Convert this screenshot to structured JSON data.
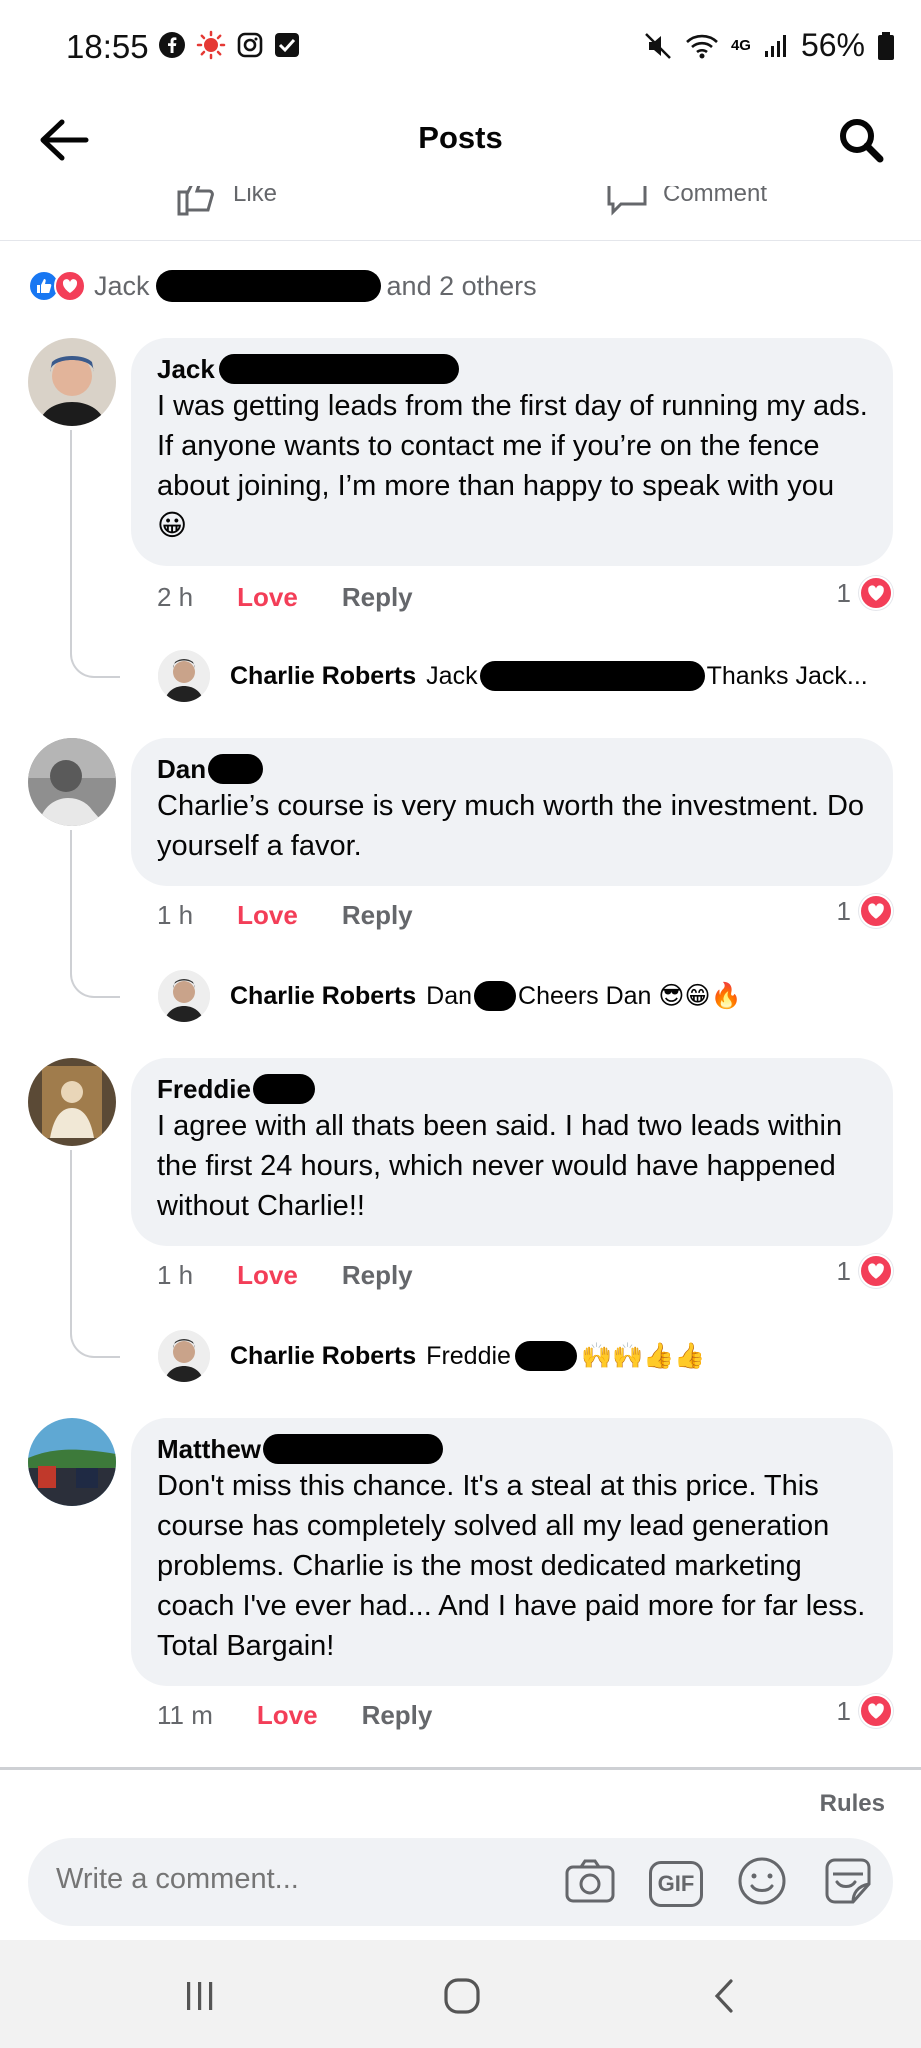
{
  "status_bar": {
    "time": "18:55",
    "battery": "56%",
    "network": "4G"
  },
  "header": {
    "title": "Posts"
  },
  "post_actions": {
    "like_label": "Like",
    "comment_label": "Comment"
  },
  "reactions_summary": {
    "first_name": "Jack",
    "others": "and 2 others"
  },
  "comments": [
    {
      "author": "Jack",
      "text": "I was getting leads from the first day of running my ads. If anyone wants to contact me if you’re on the fence about joining, I’m more than happy to speak with you 😀",
      "time": "2 h",
      "love": "Love",
      "reply": "Reply",
      "reaction_count": "1",
      "reply_preview": {
        "author": "Charlie Roberts",
        "mention": "Jack",
        "text": "Thanks Jack..."
      }
    },
    {
      "author": "Dan",
      "text": "Charlie’s course is very much worth the investment. Do yourself a favor.",
      "time": "1 h",
      "love": "Love",
      "reply": "Reply",
      "reaction_count": "1",
      "reply_preview": {
        "author": "Charlie Roberts",
        "mention": "Dan",
        "text": "Cheers Dan 😎😁🔥"
      }
    },
    {
      "author": "Freddie",
      "text": "I agree with all thats been said. I had two leads within the first 24 hours, which never would have happened without Charlie!!",
      "time": "1 h",
      "love": "Love",
      "reply": "Reply",
      "reaction_count": "1",
      "reply_preview": {
        "author": "Charlie Roberts",
        "mention": "Freddie",
        "text": "🙌🙌👍👍"
      }
    },
    {
      "author": "Matthew",
      "text": "Don't miss this chance. It's a steal at this price. This course has completely solved all my lead generation problems. Charlie is the most dedicated marketing coach I've ever had... And I have paid more for far less. Total Bargain!",
      "time": "11 m",
      "love": "Love",
      "reply": "Reply",
      "reaction_count": "1"
    }
  ],
  "composer": {
    "rules_label": "Rules",
    "placeholder": "Write a comment...",
    "gif_label": "GIF"
  },
  "colors": {
    "love": "#f33e58",
    "like": "#1877f2",
    "bubble": "#f0f2f5",
    "muted": "#65676b"
  }
}
